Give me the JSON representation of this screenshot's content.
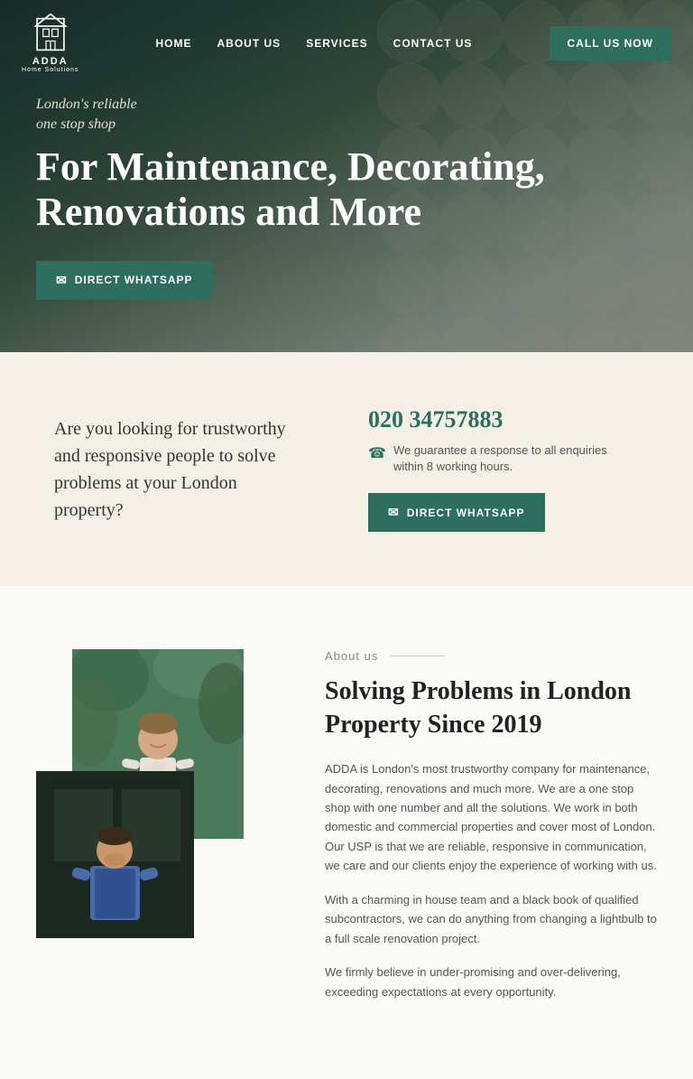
{
  "nav": {
    "logo_text": "ADDA",
    "logo_sub": "Home Solutions",
    "links": [
      {
        "id": "home",
        "label": "HOME"
      },
      {
        "id": "about",
        "label": "ABOUT US"
      },
      {
        "id": "services",
        "label": "SERVICES"
      },
      {
        "id": "contact",
        "label": "CONTACT US"
      }
    ],
    "cta_label": "CALL US NOW"
  },
  "hero": {
    "subtitle": "London's reliable\none stop shop",
    "title": "For Maintenance, Decorating, Renovations and More",
    "whatsapp_btn": "DIRECT WHATSAPP"
  },
  "contact_strip": {
    "question": "Are you looking for trustworthy and responsive people to solve problems at your London property?",
    "phone": "020 34757883",
    "guarantee": "We guarantee a response to all enquiries within 8 working hours.",
    "whatsapp_btn": "DIRECT WHATSAPP"
  },
  "about": {
    "label": "About us",
    "title": "Solving Problems in London Property Since 2019",
    "paragraph1": "ADDA is London's most trustworthy company for maintenance, decorating, renovations and much more. We are a one stop shop with one number and all the solutions. We work in both domestic and commercial properties and cover most of London. Our USP is that we are reliable, responsive in communication, we care and our clients enjoy the experience of working with us.",
    "paragraph2": "With a charming in house team and a black book of qualified subcontractors, we can do anything from changing a lightbulb to a full scale renovation project.",
    "paragraph3": "We firmly believe in under-promising and over-delivering, exceeding expectations at every opportunity."
  },
  "icons": {
    "whatsapp": "⊛",
    "phone": "☎"
  }
}
